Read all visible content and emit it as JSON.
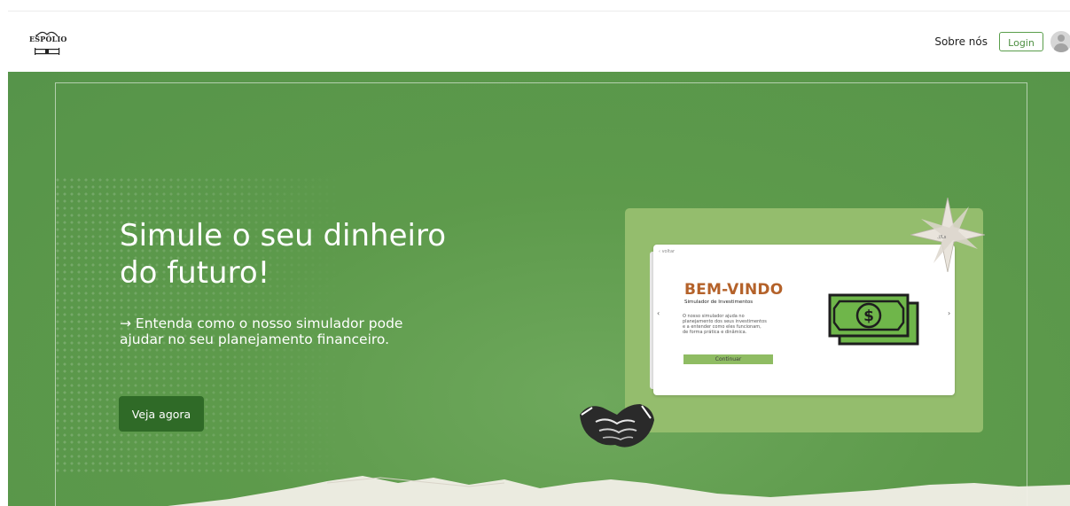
{
  "header": {
    "logo_text": "ESPÓLIO",
    "nav_about": "Sobre nós",
    "login_label": "Login"
  },
  "hero": {
    "title": "Simule o seu dinheiro do futuro!",
    "subtitle": "→ Entenda como o nosso simulador pode ajudar no seu planejamento financeiro.",
    "cta_label": "Veja agora"
  },
  "preview": {
    "back_label": "‹ voltar",
    "title": "BEM-VINDO",
    "subtitle": "Simulador de Investimentos",
    "body": "O nosso simulador ajuda no\nplanejamento dos seus investimentos\ne a entender como eles funcionam,\nde forma prática e dinâmica.",
    "button_label": "Continuar",
    "arrow_left": "‹",
    "arrow_right": "›"
  },
  "colors": {
    "hero_green": "#5d9a4b",
    "cta_green": "#2f6a27",
    "preview_green": "#94bd6d",
    "accent_orange": "#b4622a"
  },
  "icons": [
    "logo-icon",
    "avatar-icon",
    "money-icon",
    "sparkle-icon",
    "handshake-icon"
  ]
}
